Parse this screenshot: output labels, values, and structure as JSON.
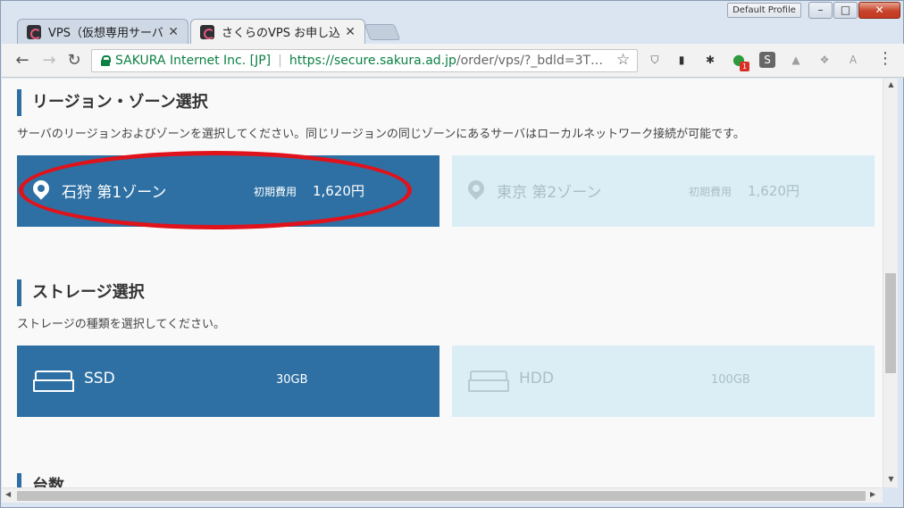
{
  "window": {
    "profile_label": "Default Profile",
    "min_glyph": "–",
    "max_glyph": "□",
    "close_glyph": "✕"
  },
  "tabs": [
    {
      "title": "VPS（仮想専用サーバー",
      "close": "✕"
    },
    {
      "title": "さくらのVPS お申し込み",
      "close": "✕"
    }
  ],
  "toolbar": {
    "back_glyph": "←",
    "forward_glyph": "→",
    "reload_glyph": "↻",
    "secure_label": "SAKURA Internet Inc. [JP]",
    "url_separator": "|",
    "url_host": "https://secure.sakura.ad.jp",
    "url_path": "/order/vps/?_bdld=3T…",
    "star_glyph": "☆",
    "menu_glyph": "⋮",
    "extensions": [
      {
        "name": "pocket-icon",
        "glyph": "⛉",
        "color": "#555555"
      },
      {
        "name": "cast-icon",
        "glyph": "▮",
        "color": "#333333"
      },
      {
        "name": "puzzle-icon",
        "glyph": "✱",
        "color": "#333333"
      },
      {
        "name": "green-circle-icon",
        "glyph": "●",
        "color": "#2b9b3d",
        "badge": "1"
      },
      {
        "name": "s-icon",
        "glyph": "S",
        "color": "#666666"
      },
      {
        "name": "drive-icon",
        "glyph": "▲",
        "color": "#9e9e9e"
      },
      {
        "name": "dropbox-icon",
        "glyph": "❖",
        "color": "#9e9e9e"
      },
      {
        "name": "pdf-icon",
        "glyph": "A",
        "color": "#9e9e9e"
      }
    ]
  },
  "region": {
    "title": "リージョン・ゾーン選択",
    "description": "サーバのリージョンおよびゾーンを選択してください。同じリージョンの同じゾーンにあるサーバはローカルネットワーク接続が可能です。",
    "options": [
      {
        "name": "石狩 第1ゾーン",
        "price_label": "初期費用",
        "price": "1,620円",
        "selected": true
      },
      {
        "name": "東京 第2ゾーン",
        "price_label": "初期費用",
        "price": "1,620円",
        "selected": false
      }
    ]
  },
  "storage": {
    "title": "ストレージ選択",
    "description": "ストレージの種類を選択してください。",
    "options": [
      {
        "name": "SSD",
        "capacity": "30GB",
        "selected": true
      },
      {
        "name": "HDD",
        "capacity": "100GB",
        "selected": false
      }
    ]
  },
  "count": {
    "title": "台数"
  },
  "colors": {
    "selected_bg": "#2e70a3",
    "unselected_bg": "#dbeef5",
    "highlight": "#e0121b",
    "accent_bar": "#2e6ea3"
  }
}
